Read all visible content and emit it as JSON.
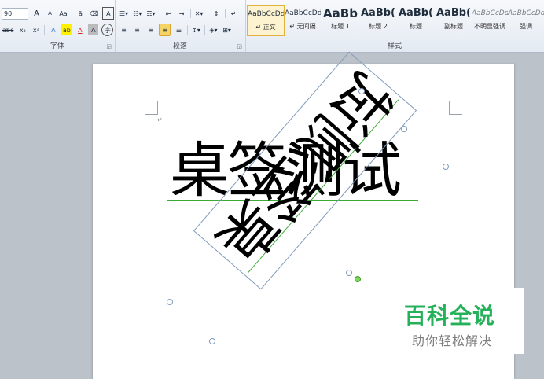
{
  "ribbon": {
    "font_group": {
      "label": "字体",
      "font_size": "90",
      "case_btn": "Aa",
      "grow_btn": "A",
      "shrink_btn": "A",
      "strike_btn": "abc",
      "subscript_btn": "x₂",
      "superscript_btn": "x²",
      "text_effect_btn": "A",
      "highlight_btn": "ab",
      "font_color_btn": "A",
      "char_shade_btn": "A",
      "enclose_btn": "字"
    },
    "paragraph_group": {
      "label": "段落"
    },
    "styles_group": {
      "label": "样式",
      "items": [
        {
          "sample": "AaBbCcDd",
          "name": "↵ 正文"
        },
        {
          "sample": "AaBbCcDd",
          "name": "↵ 无间隔"
        },
        {
          "sample": "AaBb",
          "name": "标题 1"
        },
        {
          "sample": "AaBb(",
          "name": "标题 2"
        },
        {
          "sample": "AaBb(",
          "name": "标题"
        },
        {
          "sample": "AaBb(",
          "name": "副标题"
        },
        {
          "sample": "AaBbCcDd",
          "name": "不明显强调"
        },
        {
          "sample": "AaBbCcDd",
          "name": "强调"
        }
      ]
    }
  },
  "document": {
    "main_text": "桌签测试",
    "rotated_text": "桌签测试"
  },
  "watermark": {
    "title": "百科全说",
    "subtitle": "助你轻松解决"
  },
  "colors": {
    "accent_green": "#25b05a",
    "selection_border": "#7f9bbd",
    "ribbon_bg": "#e4eaf2"
  }
}
